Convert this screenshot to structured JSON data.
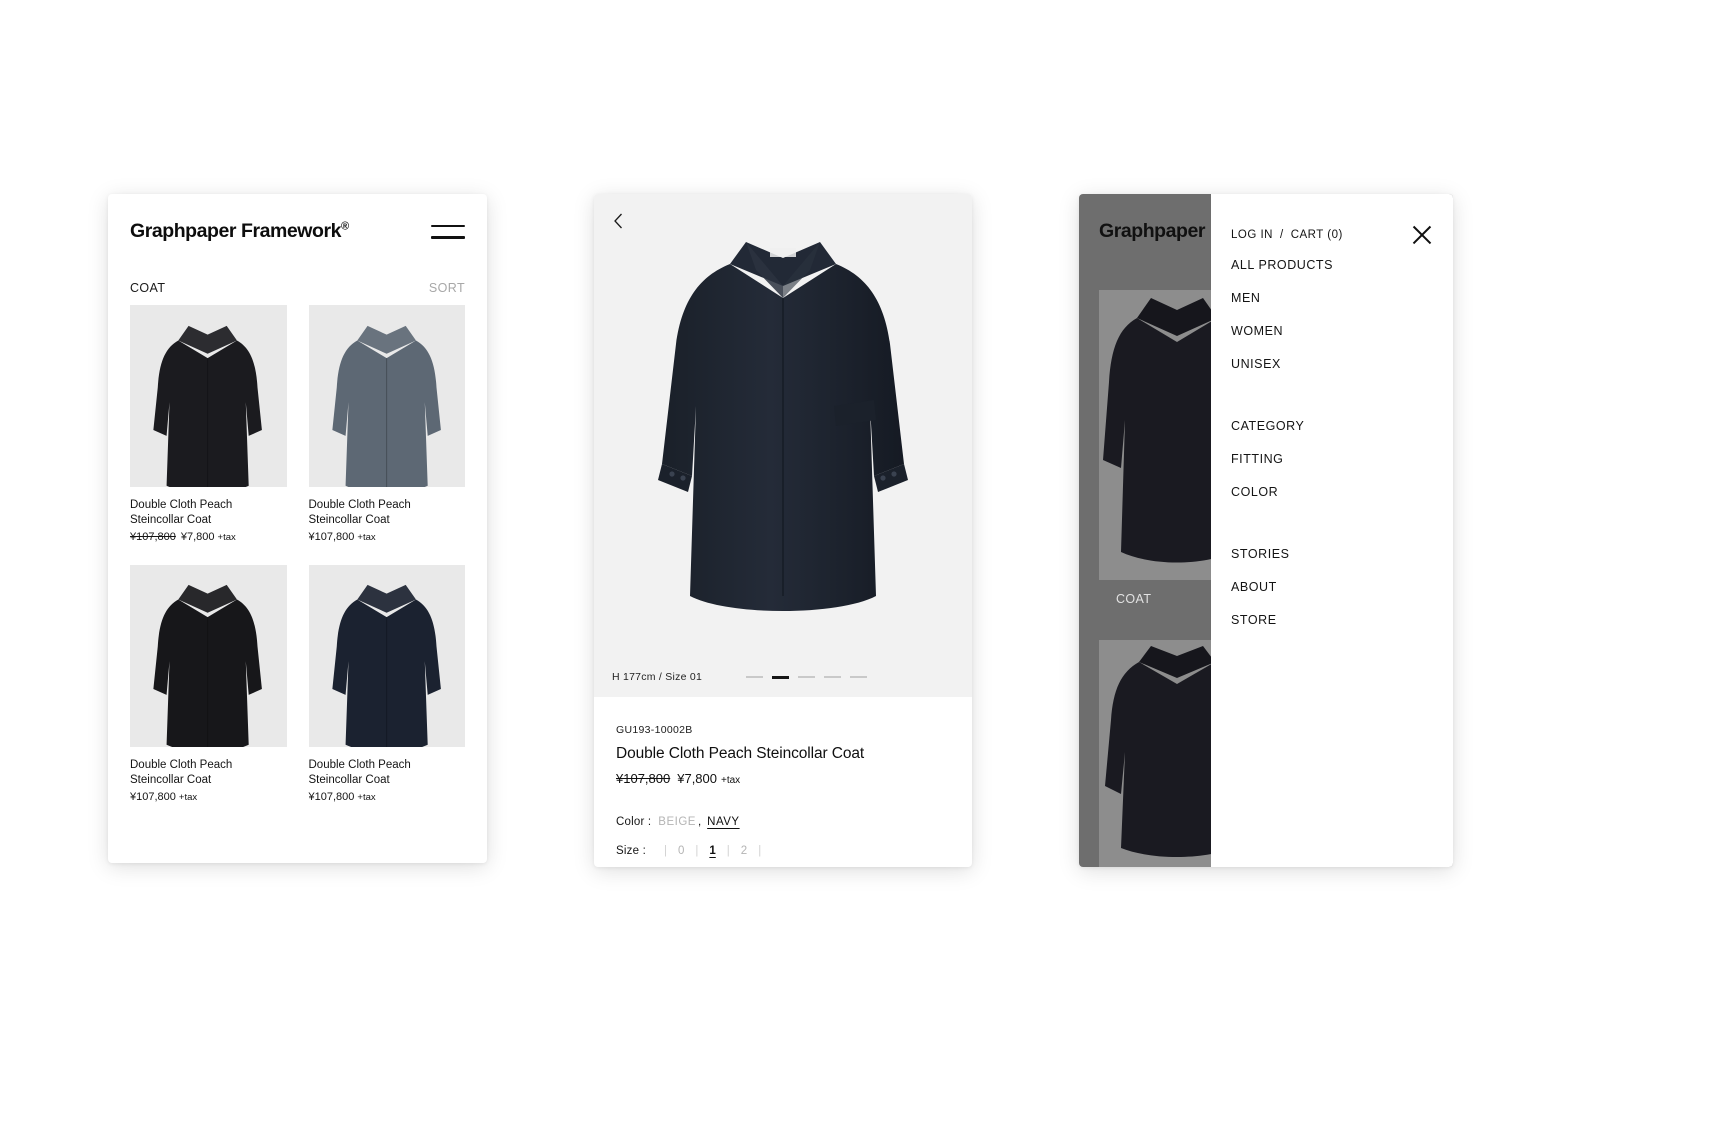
{
  "brand": {
    "name": "Graphpaper Framework",
    "registered_mark": "®"
  },
  "listing": {
    "menu_icon": "hamburger-icon",
    "category_label": "COAT",
    "sort_label": "SORT",
    "products": [
      {
        "name_line1": "Double Cloth Peach",
        "name_line2": "Steincollar Coat",
        "price_was": "¥107,800",
        "price_now": "¥7,800",
        "tax_note": "+tax",
        "on_sale": true,
        "swatch": "#1b1b1f"
      },
      {
        "name_line1": "Double Cloth Peach",
        "name_line2": "Steincollar Coat",
        "price_was": "",
        "price_now": "¥107,800",
        "tax_note": "+tax",
        "on_sale": false,
        "swatch": "#5d6874"
      },
      {
        "name_line1": "Double Cloth Peach",
        "name_line2": "Steincollar Coat",
        "price_was": "",
        "price_now": "¥107,800",
        "tax_note": "+tax",
        "on_sale": false,
        "swatch": "#17171a"
      },
      {
        "name_line1": "Double Cloth Peach",
        "name_line2": "Steincollar Coat",
        "price_was": "",
        "price_now": "¥107,800",
        "tax_note": "+tax",
        "on_sale": false,
        "swatch": "#1b2230"
      }
    ]
  },
  "detail": {
    "back_icon": "chevron-left-icon",
    "model_note": "H 177cm / Size 01",
    "carousel": {
      "count": 5,
      "active_index": 1
    },
    "sku": "GU193-10002B",
    "title": "Double Cloth Peach Steincollar Coat",
    "price_was": "¥107,800",
    "price_now": "¥7,800",
    "tax_note": "+tax",
    "color": {
      "label": "Color :",
      "separator": ",",
      "options": [
        {
          "value": "BEIGE",
          "selected": false
        },
        {
          "value": "NAVY",
          "selected": true
        }
      ]
    },
    "size": {
      "label": "Size :",
      "options": [
        {
          "value": "0",
          "selected": false
        },
        {
          "value": "1",
          "selected": true
        },
        {
          "value": "2",
          "selected": false
        }
      ]
    },
    "hero_color": "#1e2430"
  },
  "nav_drawer": {
    "login_label": "LOG IN",
    "slash": "/",
    "cart_label": "CART (0)",
    "close_icon": "close-icon",
    "groups": [
      [
        "ALL PRODUCTS",
        "MEN",
        "WOMEN",
        "UNISEX"
      ],
      [
        "CATEGORY",
        "FITTING",
        "COLOR"
      ],
      [
        "STORIES",
        "ABOUT",
        "STORE"
      ]
    ],
    "background_category_label": "COAT"
  },
  "colors": {
    "page_background": "#ffffff",
    "card_background": "#ffffff",
    "thumb_background": "#e9e9e9",
    "hero_background": "#f2f2f2",
    "dim_overlay": "#6e6e6e",
    "text_primary": "#141414",
    "text_muted": "#b4b4b4"
  }
}
